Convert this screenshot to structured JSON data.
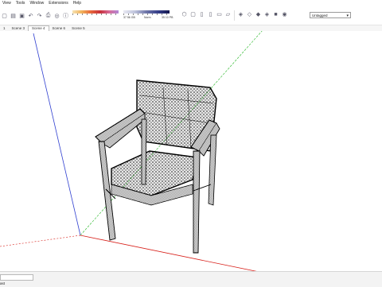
{
  "menu": [
    "View",
    "Tools",
    "Window",
    "Extensions",
    "Help"
  ],
  "toolbar": {
    "memory_used": "37 56 GB",
    "memory_free": "Norm",
    "memory_total": "35 10 PB",
    "tag_value": "Untagged",
    "icons": [
      "new-icon",
      "open-icon",
      "save-icon",
      "undo-icon",
      "redo-icon",
      "print-icon",
      "orbit-icon",
      "info-icon",
      "iso-view-icon",
      "top-view-icon",
      "front-view-icon",
      "right-view-icon",
      "back-view-icon",
      "left-view-icon",
      "xray-icon",
      "wireframe-icon",
      "hidden-line-icon",
      "shaded-icon",
      "textured-icon",
      "monochrome-icon"
    ]
  },
  "tabs": [
    {
      "label": "1",
      "active": false
    },
    {
      "label": "Scene 3",
      "active": false
    },
    {
      "label": "Scene 4",
      "active": true
    },
    {
      "label": "Scene 6",
      "active": false
    },
    {
      "label": "Scene 5",
      "active": false
    }
  ],
  "viewport": {
    "axis_colors": {
      "green": "#3fbf3f",
      "red": "#d8201a",
      "blue": "#2f3fd0"
    },
    "model": "wireframe-chair"
  },
  "status": {
    "text": "ast"
  }
}
